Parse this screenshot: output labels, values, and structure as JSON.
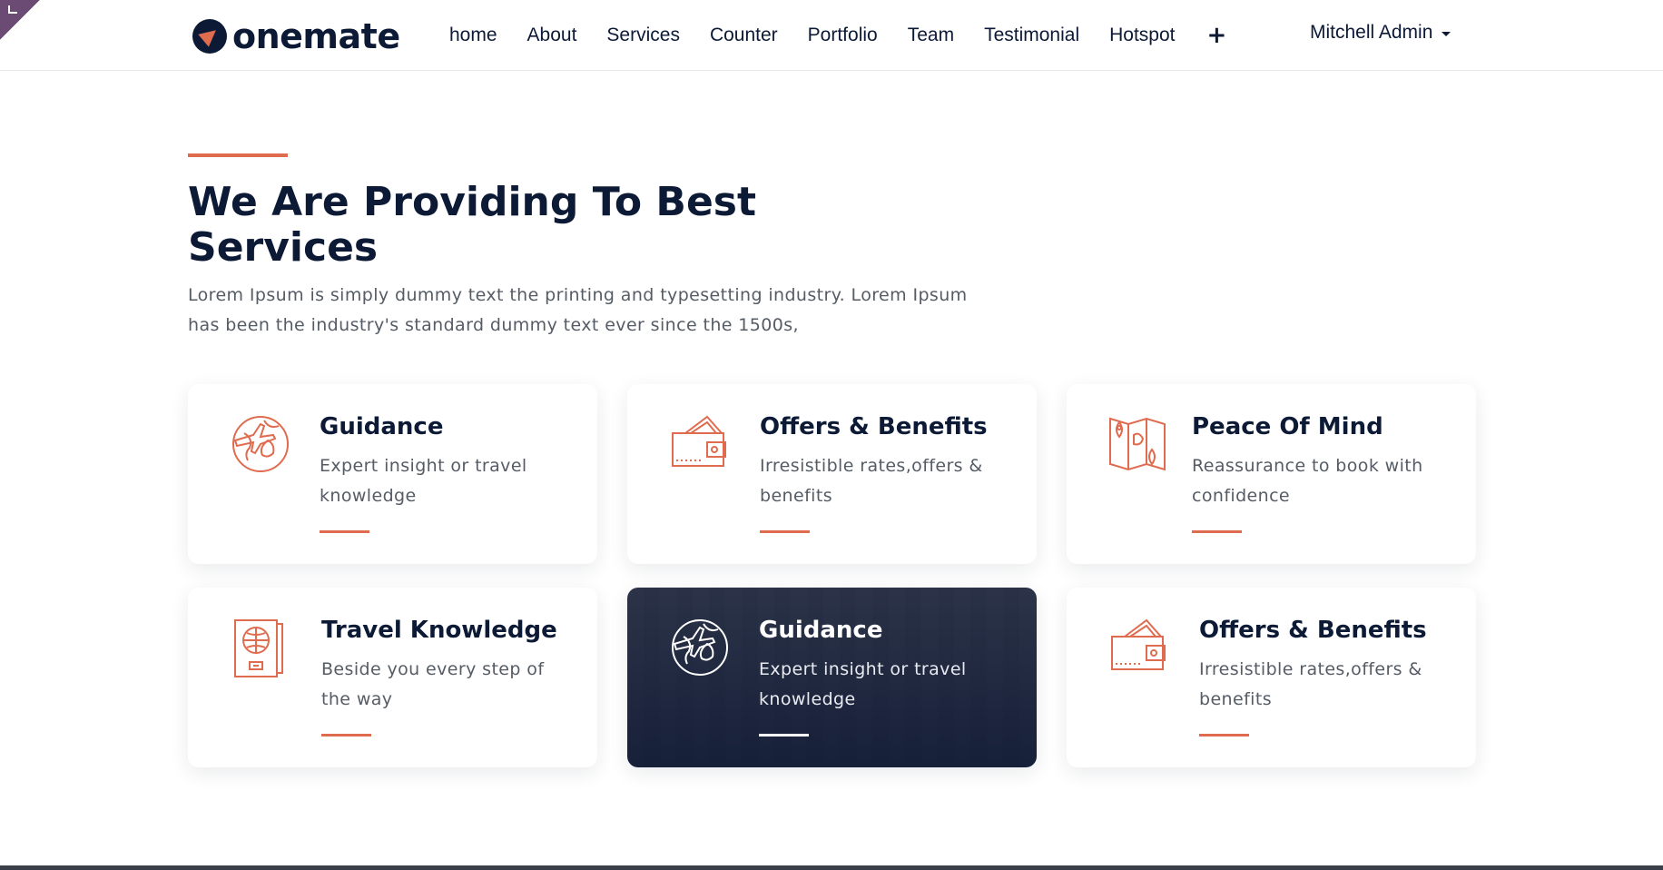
{
  "brand": {
    "name": "onemate"
  },
  "nav": {
    "items": [
      "home",
      "About",
      "Services",
      "Counter",
      "Portfolio",
      "Team",
      "Testimonial",
      "Hotspot"
    ],
    "add_label": "+",
    "user": "Mitchell Admin"
  },
  "section": {
    "heading": "We Are Providing To Best Services",
    "intro": "Lorem Ipsum is simply dummy text the printing and typesetting industry. Lorem Ipsum has been the industry's standard dummy text ever since the 1500s,"
  },
  "cards": [
    {
      "title": "Guidance",
      "desc": "Expert insight or travel knowledge",
      "icon": "globe-plane-icon"
    },
    {
      "title": "Offers & Benefits",
      "desc": "Irresistible rates,offers & benefits",
      "icon": "wallet-icon"
    },
    {
      "title": "Peace Of Mind",
      "desc": "Reassurance to book with confidence",
      "icon": "map-pin-icon"
    },
    {
      "title": "Travel Knowledge",
      "desc": "Beside you every step of the way",
      "icon": "passport-icon"
    },
    {
      "title": "Guidance",
      "desc": "Expert insight or travel knowledge",
      "icon": "globe-plane-icon"
    },
    {
      "title": "Offers & Benefits",
      "desc": "Irresistible rates,offers & benefits",
      "icon": "wallet-icon"
    }
  ],
  "colors": {
    "accent": "#e06c4f",
    "navy": "#0c1a36",
    "body_text": "#555c66"
  }
}
